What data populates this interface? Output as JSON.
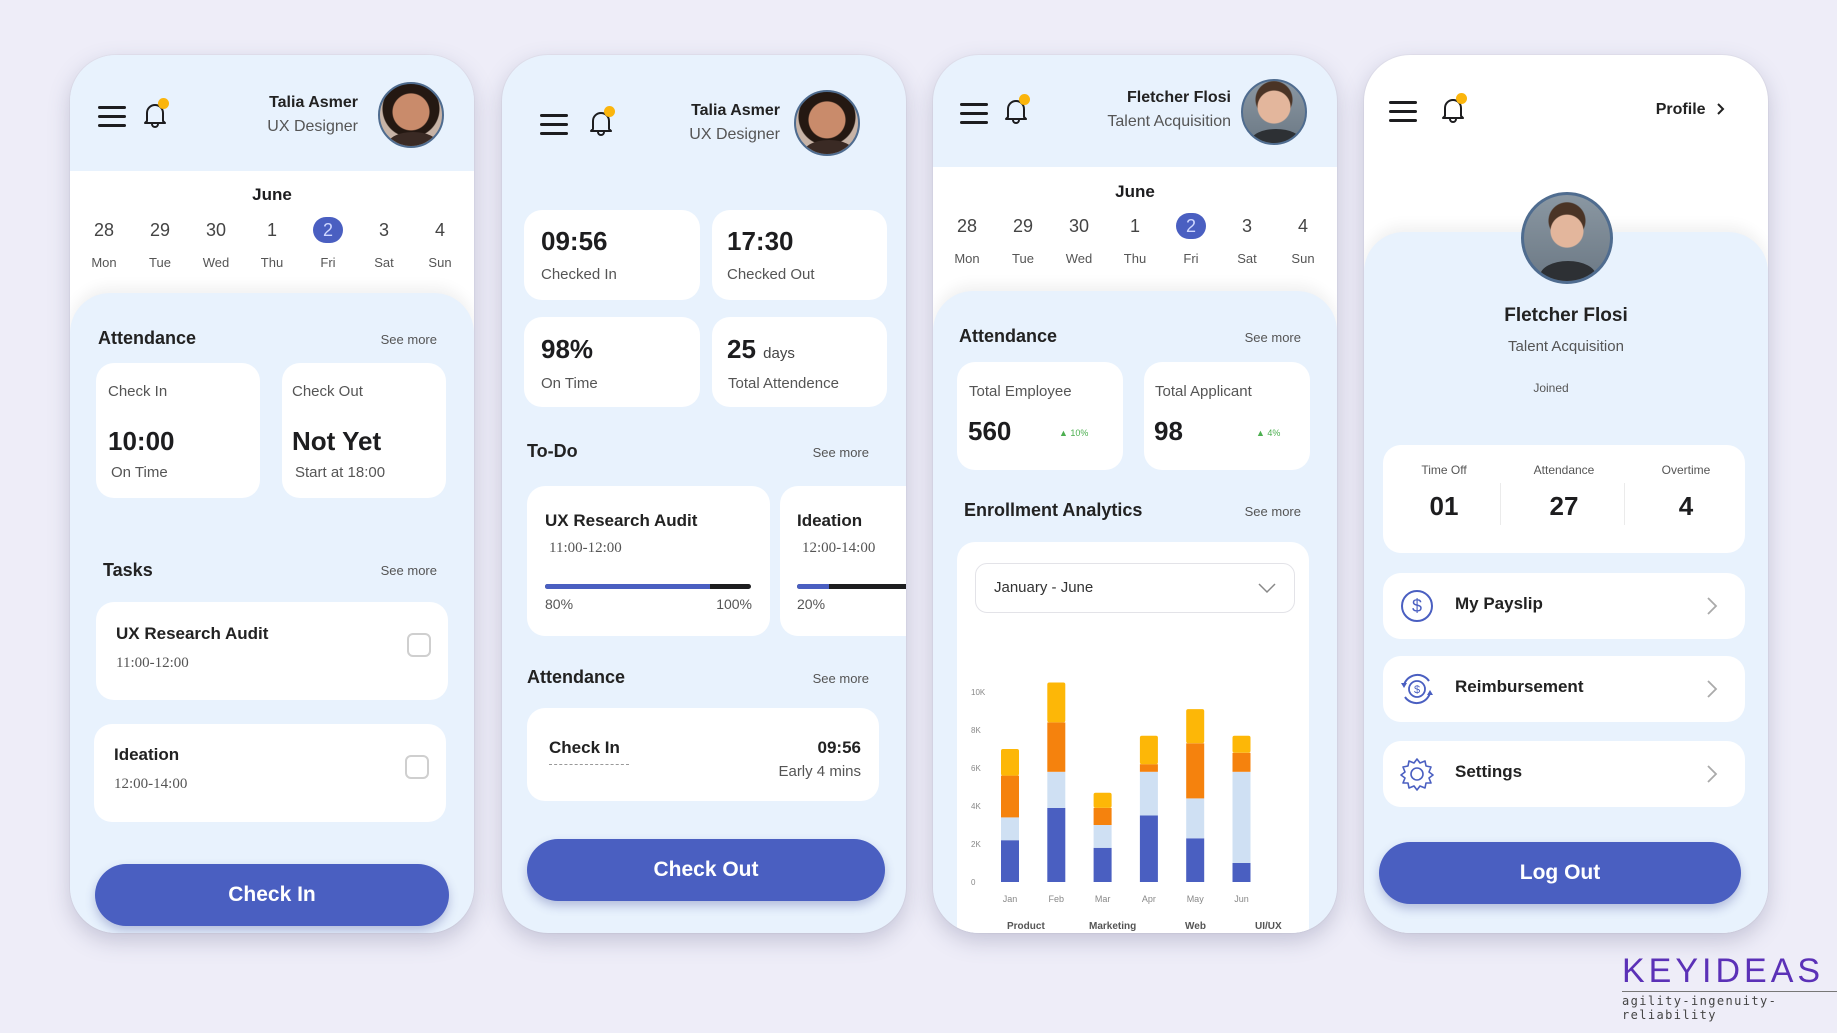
{
  "phones": {
    "employee_home": {
      "user": {
        "name": "Talia Asmer",
        "role": "UX Designer"
      },
      "calendar": {
        "month": "June",
        "days": [
          {
            "num": "28",
            "day": "Mon"
          },
          {
            "num": "29",
            "day": "Tue"
          },
          {
            "num": "30",
            "day": "Wed"
          },
          {
            "num": "1",
            "day": "Thu"
          },
          {
            "num": "2",
            "day": "Fri",
            "selected": true
          },
          {
            "num": "3",
            "day": "Sat"
          },
          {
            "num": "4",
            "day": "Sun"
          }
        ]
      },
      "attendance": {
        "title": "Attendance",
        "see_more": "See more",
        "check_in": {
          "label": "Check In",
          "value": "10:00",
          "status": "On Time"
        },
        "check_out": {
          "label": "Check Out",
          "value": "Not Yet",
          "status": "Start at 18:00"
        }
      },
      "tasks": {
        "title": "Tasks",
        "see_more": "See more",
        "items": [
          {
            "title": "UX Research Audit",
            "time": "11:00-12:00",
            "checked": false
          },
          {
            "title": "Ideation",
            "time": "12:00-14:00",
            "checked": false
          }
        ]
      },
      "button": "Check In"
    },
    "employee_checked_in": {
      "user": {
        "name": "Talia Asmer",
        "role": "UX Designer"
      },
      "stats": [
        {
          "value": "09:56",
          "unit": "",
          "label": "Checked In"
        },
        {
          "value": "17:30",
          "unit": "",
          "label": "Checked Out"
        },
        {
          "value": "98%",
          "unit": "",
          "label": "On Time"
        },
        {
          "value": "25",
          "unit": "days",
          "label": "Total Attendence"
        }
      ],
      "todo": {
        "title": "To-Do",
        "see_more": "See more",
        "items": [
          {
            "title": "UX Research Audit",
            "time": "11:00-12:00",
            "progress": 80,
            "progress_label": "80%",
            "max_label": "100%"
          },
          {
            "title": "Ideation",
            "time": "12:00-14:00",
            "progress": 20,
            "progress_label": "20%"
          }
        ]
      },
      "attendance": {
        "title": "Attendance",
        "see_more": "See more",
        "entry": {
          "label": "Check In",
          "time": "09:56",
          "note": "Early 4 mins"
        }
      },
      "button": "Check Out"
    },
    "hr_dashboard": {
      "user": {
        "name": "Fletcher Flosi",
        "role": "Talent Acquisition"
      },
      "calendar": {
        "month": "June",
        "days": [
          {
            "num": "28",
            "day": "Mon"
          },
          {
            "num": "29",
            "day": "Tue"
          },
          {
            "num": "30",
            "day": "Wed"
          },
          {
            "num": "1",
            "day": "Thu"
          },
          {
            "num": "2",
            "day": "Fri",
            "selected": true
          },
          {
            "num": "3",
            "day": "Sat"
          },
          {
            "num": "4",
            "day": "Sun"
          }
        ]
      },
      "attendance": {
        "title": "Attendance",
        "see_more": "See more",
        "total_employee": {
          "label": "Total Employee",
          "value": "560",
          "change": "▲ 10%"
        },
        "total_applicant": {
          "label": "Total Applicant",
          "value": "98",
          "change": "▲ 4%"
        }
      },
      "analytics": {
        "title": "Enrollment Analytics",
        "see_more": "See more",
        "range_select": "January - June"
      }
    },
    "profile": {
      "header_link": "Profile",
      "user": {
        "name": "Fletcher Flosi",
        "role": "Talent Acquisition",
        "joined_label": "Joined"
      },
      "stats": [
        {
          "label": "Time Off",
          "value": "01"
        },
        {
          "label": "Attendance",
          "value": "27"
        },
        {
          "label": "Overtime",
          "value": "4"
        }
      ],
      "menu": [
        {
          "label": "My Payslip",
          "icon": "dollar-circle-icon"
        },
        {
          "label": "Reimbursement",
          "icon": "refund-dollar-icon"
        },
        {
          "label": "Settings",
          "icon": "gear-icon"
        }
      ],
      "button": "Log Out"
    }
  },
  "colors": {
    "primary": "#4a5fc1",
    "notification": "#fbb50c",
    "panel": "#e8f2fd",
    "positive": "#4caf50"
  },
  "brand": {
    "name": "KEYIDEAS",
    "tagline": "agility-ingenuity-reliability"
  },
  "chart_data": {
    "type": "bar",
    "stacked": true,
    "title": "Enrollment Analytics",
    "categories": [
      "Jan",
      "Feb",
      "Mar",
      "Apr",
      "May",
      "Jun"
    ],
    "series": [
      {
        "name": "Product",
        "color": "#4a5fc1",
        "values": [
          2.2,
          3.9,
          1.8,
          3.5,
          2.3,
          1.0
        ]
      },
      {
        "name": "Marketing",
        "color": "#cfe0f3",
        "values": [
          1.2,
          1.9,
          1.2,
          2.3,
          2.1,
          4.8
        ]
      },
      {
        "name": "Web",
        "color": "#f5820d",
        "values": [
          2.2,
          2.6,
          0.9,
          0.4,
          2.9,
          1.0
        ]
      },
      {
        "name": "UI/UX",
        "color": "#fdb707",
        "values": [
          1.4,
          2.1,
          0.8,
          1.5,
          1.8,
          0.9
        ]
      }
    ],
    "yticks": [
      "0",
      "2K",
      "4K",
      "6K",
      "8K",
      "10K"
    ],
    "ylim": [
      0,
      10
    ],
    "yunit": "thousands",
    "xlabel": "",
    "ylabel": "",
    "grid": false,
    "legend": "bottom"
  }
}
